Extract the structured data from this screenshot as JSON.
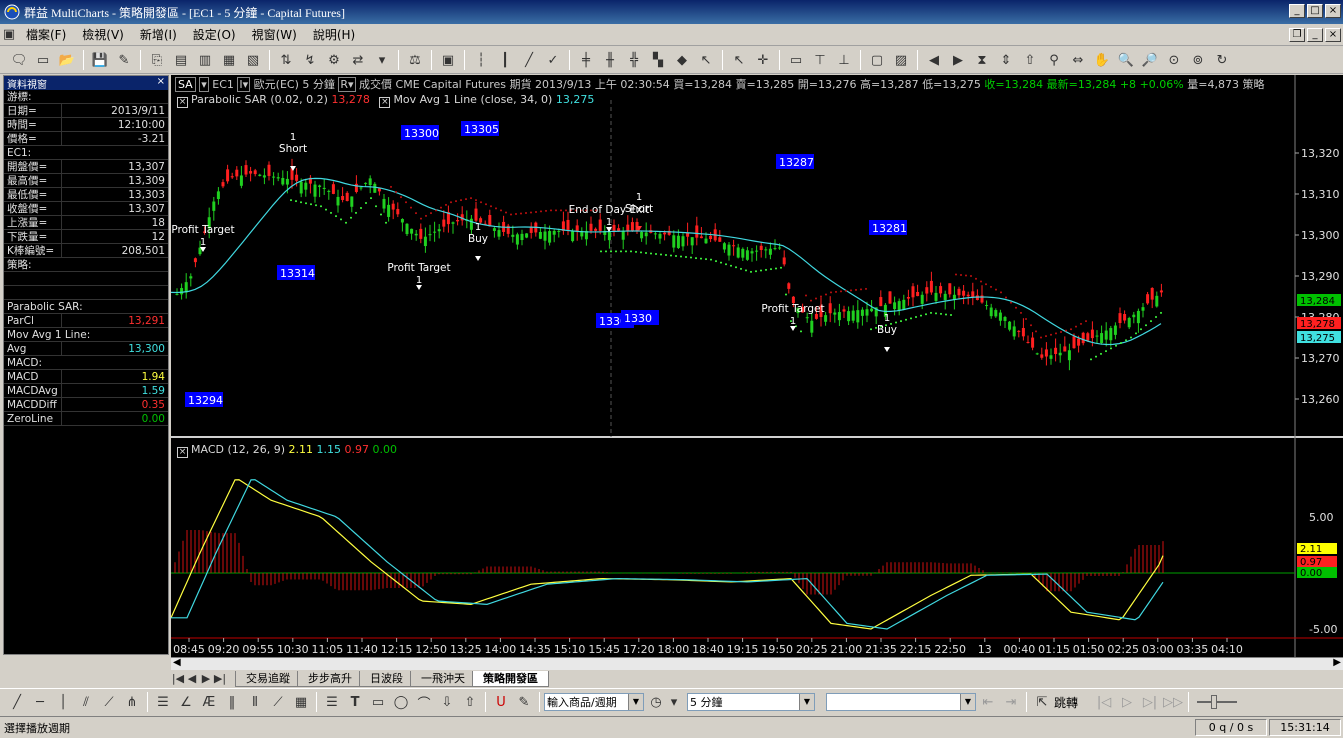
{
  "window": {
    "title": "群益 MultiCharts - 策略開發區 - [EC1 - 5 分鐘 - Capital Futures]",
    "min": "_",
    "max": "□",
    "close": "×"
  },
  "menu": [
    "檔案(F)",
    "檢視(V)",
    "新增(I)",
    "設定(O)",
    "視窗(W)",
    "說明(H)"
  ],
  "data_window": {
    "title": "資料視窗",
    "cursor_header": "游標:",
    "rows_top": [
      {
        "k": "日期=",
        "v": "2013/9/11"
      },
      {
        "k": "時間=",
        "v": "12:10:00"
      },
      {
        "k": "價格=",
        "v": "-3.21"
      }
    ],
    "symbol_header": "EC1:",
    "rows_symbol": [
      {
        "k": "開盤價=",
        "v": "13,307"
      },
      {
        "k": "最高價=",
        "v": "13,309"
      },
      {
        "k": "最低價=",
        "v": "13,303"
      },
      {
        "k": "收盤價=",
        "v": "13,307"
      },
      {
        "k": "上漲量=",
        "v": "18"
      },
      {
        "k": "下跌量=",
        "v": "12"
      },
      {
        "k": "K棒編號=",
        "v": "208,501"
      }
    ],
    "strategy_header": "策略:",
    "psar_header": "Parabolic SAR:",
    "psar_rows": [
      {
        "k": "ParCl",
        "v": "13,291",
        "color": "#ff3030"
      }
    ],
    "ma_header": "Mov Avg 1 Line:",
    "ma_rows": [
      {
        "k": "Avg",
        "v": "13,300",
        "color": "#40e0e0"
      }
    ],
    "macd_header": "MACD:",
    "macd_rows": [
      {
        "k": "MACD",
        "v": "1.94",
        "color": "#ffff40"
      },
      {
        "k": "MACDAvg",
        "v": "1.59",
        "color": "#40e0e0"
      },
      {
        "k": "MACDDiff",
        "v": "0.35",
        "color": "#ff3030"
      },
      {
        "k": "ZeroLine",
        "v": "0.00",
        "color": "#00c000"
      }
    ]
  },
  "chart": {
    "header": {
      "symbol_btn": "SA",
      "symbol": "EC1",
      "instrument": "歐元(EC) 5 分鐘",
      "price_type": "成交價",
      "exchange": "CME",
      "broker": "Capital Futures",
      "category": "期貨",
      "datetime": "2013/9/13 上午 02:30:54",
      "bid": "買=13,284",
      "ask": "賣=13,285",
      "open": "開=13,276",
      "high": "高=13,287",
      "low": "低=13,275",
      "close": "收=13,284",
      "last": "最新=13,284",
      "change": "+8",
      "pct": "+0.06%",
      "volume": "量=4,873",
      "strategy": "策略"
    },
    "indicator1": {
      "psar_label": "Parabolic SAR (0.02, 0.2)",
      "psar_val": "13,278",
      "ma_label": "Mov Avg 1 Line (close, 34, 0)",
      "ma_val": "13,275"
    },
    "indicator2": {
      "label": "MACD (12, 26, 9)",
      "v1": "2.11",
      "v2": "1.15",
      "v3": "0.97",
      "v4": "0.00"
    },
    "price_axis": [
      "13,320",
      "13,310",
      "13,300",
      "13,290",
      "13,280",
      "13,270",
      "13,260"
    ],
    "price_tags": [
      "13,284",
      "13,278",
      "13,275"
    ],
    "macd_axis": [
      "5.00",
      "-5.00"
    ],
    "macd_tags": [
      "2.11",
      "0.97",
      "0.00"
    ],
    "time_axis": [
      "08:45",
      "09:20",
      "09:55",
      "10:30",
      "11:05",
      "11:40",
      "12:15",
      "12:50",
      "13:25",
      "14:00",
      "14:35",
      "15:10",
      "15:45",
      "17:20",
      "18:00",
      "18:40",
      "19:15",
      "19:50",
      "20:25",
      "21:00",
      "21:35",
      "22:15",
      "22:50",
      "13",
      "00:40",
      "01:15",
      "01:50",
      "02:25",
      "03:00",
      "03:35",
      "04:10"
    ],
    "blue_labels": [
      "13300",
      "13305",
      "13287",
      "13281",
      "13314",
      "13301",
      "1330",
      "13294"
    ],
    "signal_labels": [
      "Profit Target",
      "Short",
      "Profit Target",
      "Buy",
      "End of Day Exit",
      "Short",
      "Profit Target",
      "Buy"
    ],
    "signal_qty": "1"
  },
  "tabs": [
    "交易追蹤",
    "步步高升",
    "日波段",
    "一飛沖天",
    "策略開發區"
  ],
  "drawbar": {
    "combo1": "輸入商品/週期",
    "combo2": "5 分鐘",
    "combo3": "",
    "jump": "跳轉"
  },
  "status": {
    "main": "選擇播放週期",
    "queue": "0 q / 0 s",
    "time": "15:31:14"
  }
}
